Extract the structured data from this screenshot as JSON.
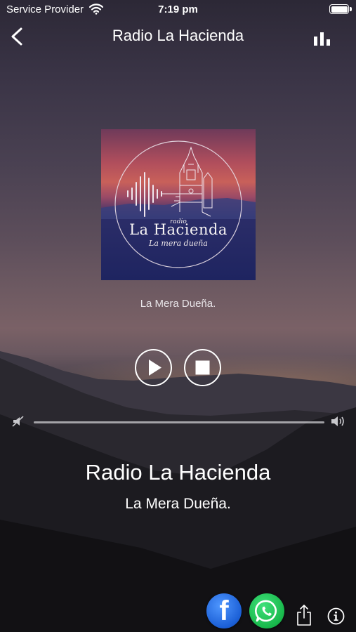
{
  "status_bar": {
    "carrier": "Service Provider",
    "time": "7:19 pm",
    "battery_level": 1.0
  },
  "nav": {
    "title": "Radio La Hacienda",
    "back_icon": "chevron-left-icon",
    "equalizer_icon": "bar-chart-icon"
  },
  "artwork": {
    "radio_word": "radio",
    "name": "La Hacienda",
    "slogan": "La mera dueña"
  },
  "now_playing": {
    "subtitle": "La Mera Dueña.",
    "station_name": "Radio La Hacienda",
    "station_slogan": "La Mera Dueña."
  },
  "controls": {
    "play_icon": "play-icon",
    "stop_icon": "stop-icon"
  },
  "volume": {
    "level": 1.0,
    "low_icon": "volume-mute-icon",
    "high_icon": "volume-high-icon"
  },
  "social": {
    "facebook_letter": "f",
    "facebook_color": "#1b5fd6",
    "whatsapp_color": "#18b84b",
    "share_icon": "share-icon",
    "info_icon": "info-icon"
  }
}
